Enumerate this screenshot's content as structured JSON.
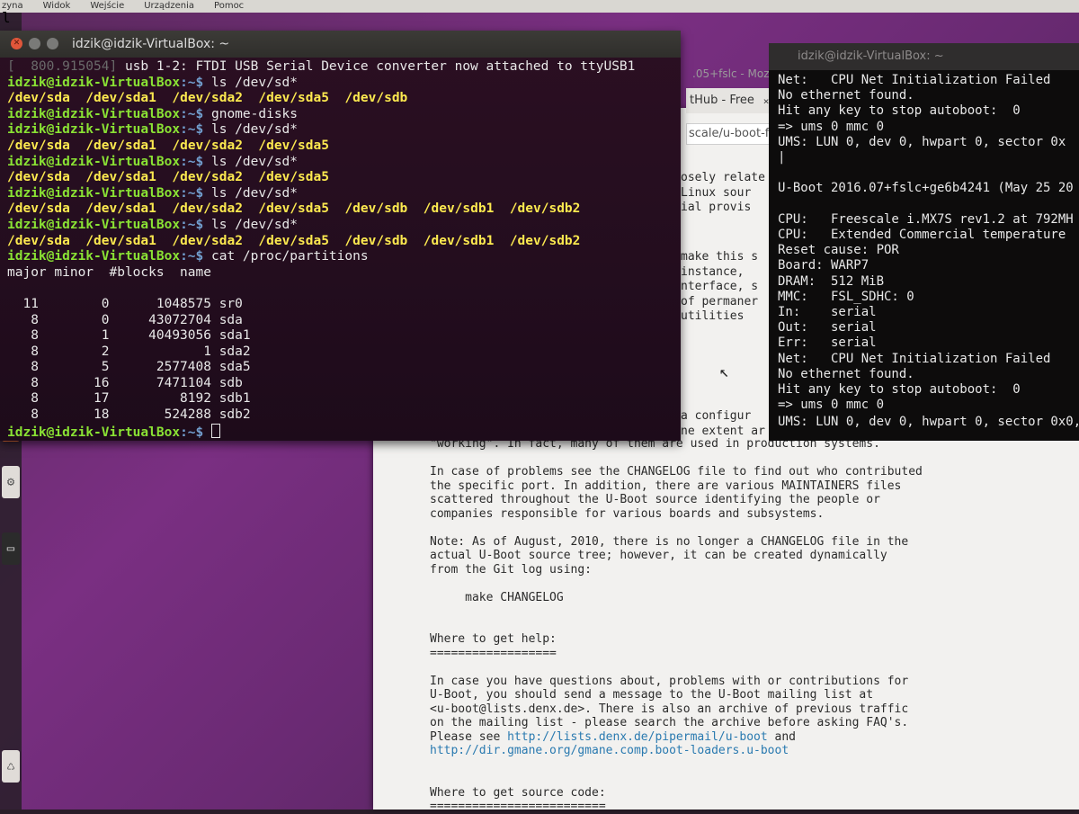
{
  "menubar": {
    "items": [
      "zyna",
      "Widok",
      "Wejście",
      "Urządzenia",
      "Pomoc"
    ],
    "left_char": "l"
  },
  "launcher": {
    "icons": [
      "files-icon",
      "browser-icon",
      "office-icon",
      "settings-icon",
      "terminal-icon",
      "trash-icon"
    ]
  },
  "terminal": {
    "title": "idzik@idzik-VirtualBox: ~",
    "kernel_line": {
      "ts": "[  800.915054]",
      "msg": " usb 1-2: FTDI USB Serial Device converter now attached to ttyUSB1"
    },
    "prompt_user": "idzik@idzik-VirtualBox",
    "prompt_path": ":~$ ",
    "lines": [
      {
        "type": "cmd",
        "text": "ls /dev/sd*"
      },
      {
        "type": "devs",
        "items": [
          "/dev/sda",
          "/dev/sda1",
          "/dev/sda2",
          "/dev/sda5",
          "/dev/sdb"
        ]
      },
      {
        "type": "cmd",
        "text": "gnome-disks"
      },
      {
        "type": "cmd",
        "text": "ls /dev/sd*"
      },
      {
        "type": "devs",
        "items": [
          "/dev/sda",
          "/dev/sda1",
          "/dev/sda2",
          "/dev/sda5"
        ]
      },
      {
        "type": "cmd",
        "text": "ls /dev/sd*"
      },
      {
        "type": "devs",
        "items": [
          "/dev/sda",
          "/dev/sda1",
          "/dev/sda2",
          "/dev/sda5"
        ]
      },
      {
        "type": "cmd",
        "text": "ls /dev/sd*"
      },
      {
        "type": "devs",
        "items": [
          "/dev/sda",
          "/dev/sda1",
          "/dev/sda2",
          "/dev/sda5",
          "/dev/sdb",
          "/dev/sdb1",
          "/dev/sdb2"
        ]
      },
      {
        "type": "cmd",
        "text": "ls /dev/sd*"
      },
      {
        "type": "devs",
        "items": [
          "/dev/sda",
          "/dev/sda1",
          "/dev/sda2",
          "/dev/sda5",
          "/dev/sdb",
          "/dev/sdb1",
          "/dev/sdb2"
        ]
      },
      {
        "type": "cmd",
        "text": "cat /proc/partitions"
      }
    ],
    "partitions": {
      "header": "major minor  #blocks  name",
      "rows": [
        [
          "11",
          "0",
          "1048575",
          "sr0"
        ],
        [
          "8",
          "0",
          "43072704",
          "sda"
        ],
        [
          "8",
          "1",
          "40493056",
          "sda1"
        ],
        [
          "8",
          "2",
          "1",
          "sda2"
        ],
        [
          "8",
          "5",
          "2577408",
          "sda5"
        ],
        [
          "8",
          "16",
          "7471104",
          "sdb"
        ],
        [
          "8",
          "17",
          "8192",
          "sdb1"
        ],
        [
          "8",
          "18",
          "524288",
          "sdb2"
        ]
      ]
    }
  },
  "browser": {
    "tab_title": "tHub - Free",
    "tab_title_faded": ".05+fslc - Moz",
    "url": "scale/u-boot-fs",
    "frag1": [
      "osely relate",
      "Linux sour",
      "ial provis"
    ],
    "frag2": [
      "make this s",
      "instance,",
      "nterface, s",
      "of permaner",
      "utilities"
    ],
    "frag3": [
      "a configur",
      "ne extent ar"
    ],
    "close_glyph": "×"
  },
  "readme": {
    "line0": "\"working\". In fact, many of them are used in production systems.",
    "para1": [
      "In case of problems see the CHANGELOG file to find out who contributed",
      "the specific port. In addition, there are various MAINTAINERS files",
      "scattered throughout the U-Boot source identifying the people or",
      "companies responsible for various boards and subsystems."
    ],
    "para2": [
      "Note: As of August, 2010, there is no longer a CHANGELOG file in the",
      "actual U-Boot source tree; however, it can be created dynamically",
      "from the Git log using:"
    ],
    "make_cmd": "make CHANGELOG",
    "help_heading": "Where to get help:",
    "help_rule": "==================",
    "help_para": [
      "In case you have questions about, problems with or contributions for",
      "U-Boot, you should send a message to the U-Boot mailing list at",
      "<u-boot@lists.denx.de>. There is also an archive of previous traffic",
      "on the mailing list - please search the archive before asking FAQ's."
    ],
    "please_see": "Please see ",
    "link1": "http://lists.denx.de/pipermail/u-boot",
    "and": " and",
    "link2": "http://dir.gmane.org/gmane.comp.boot-loaders.u-boot",
    "source_heading": "Where to get source code:",
    "source_rule": "========================="
  },
  "serial": {
    "title": "idzik@idzik-VirtualBox: ~",
    "lines": [
      "Net:   CPU Net Initialization Failed",
      "No ethernet found.",
      "Hit any key to stop autoboot:  0",
      "=> ums 0 mmc 0",
      "UMS: LUN 0, dev 0, hwpart 0, sector 0x",
      "|",
      "",
      "U-Boot 2016.07+fslc+ge6b4241 (May 25 20",
      "",
      "CPU:   Freescale i.MX7S rev1.2 at 792MH",
      "CPU:   Extended Commercial temperature",
      "Reset cause: POR",
      "Board: WARP7",
      "DRAM:  512 MiB",
      "MMC:   FSL_SDHC: 0",
      "In:    serial",
      "Out:   serial",
      "Err:   serial",
      "Net:   CPU Net Initialization Failed",
      "No ethernet found.",
      "Hit any key to stop autoboot:  0",
      "=> ums 0 mmc 0",
      "UMS: LUN 0, dev 0, hwpart 0, sector 0x0,"
    ]
  }
}
